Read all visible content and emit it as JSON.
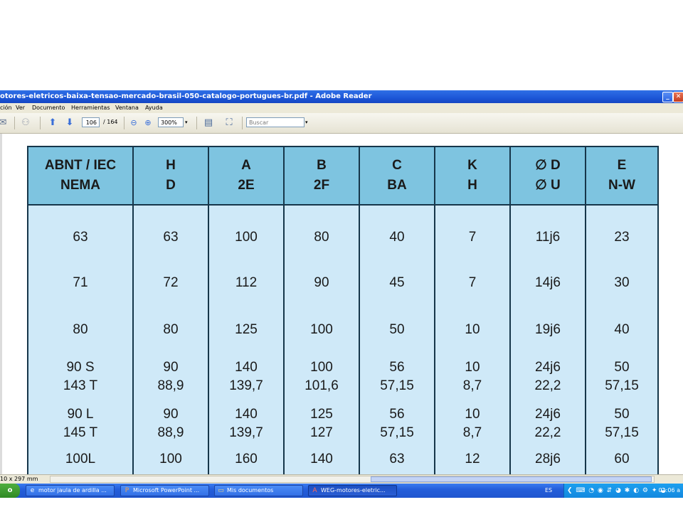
{
  "window": {
    "title": "otores-eletricos-baixa-tensao-mercado-brasil-050-catalogo-portugues-br.pdf - Adobe Reader",
    "minimize_glyph": "_",
    "maximize_glyph": "□",
    "close_glyph": "✕"
  },
  "menu": {
    "items": [
      "ción",
      "Ver",
      "Documento",
      "Herramientas",
      "Ventana",
      "Ayuda"
    ]
  },
  "toolbar": {
    "page_current": "106",
    "page_total": "/ 164",
    "zoom": "300%",
    "search_placeholder": "Buscar"
  },
  "table": {
    "headers": [
      [
        "ABNT / IEC",
        "NEMA"
      ],
      [
        "H",
        "D"
      ],
      [
        "A",
        "2E"
      ],
      [
        "B",
        "2F"
      ],
      [
        "C",
        "BA"
      ],
      [
        "K",
        "H"
      ],
      [
        "∅ D",
        "∅ U"
      ],
      [
        "E",
        "N-W"
      ]
    ],
    "rows": [
      [
        [
          "63"
        ],
        [
          "63"
        ],
        [
          "100"
        ],
        [
          "80"
        ],
        [
          "40"
        ],
        [
          "7"
        ],
        [
          "11j6"
        ],
        [
          "23"
        ]
      ],
      [
        [
          "71"
        ],
        [
          "72"
        ],
        [
          "112"
        ],
        [
          "90"
        ],
        [
          "45"
        ],
        [
          "7"
        ],
        [
          "14j6"
        ],
        [
          "30"
        ]
      ],
      [
        [
          "80"
        ],
        [
          "80"
        ],
        [
          "125"
        ],
        [
          "100"
        ],
        [
          "50"
        ],
        [
          "10"
        ],
        [
          "19j6"
        ],
        [
          "40"
        ]
      ],
      [
        [
          "90 S",
          "143 T"
        ],
        [
          "90",
          "88,9"
        ],
        [
          "140",
          "139,7"
        ],
        [
          "100",
          "101,6"
        ],
        [
          "56",
          "57,15"
        ],
        [
          "10",
          "8,7"
        ],
        [
          "24j6",
          "22,2"
        ],
        [
          "50",
          "57,15"
        ]
      ],
      [
        [
          "90 L",
          "145 T"
        ],
        [
          "90",
          "88,9"
        ],
        [
          "140",
          "139,7"
        ],
        [
          "125",
          "127"
        ],
        [
          "56",
          "57,15"
        ],
        [
          "10",
          "8,7"
        ],
        [
          "24j6",
          "22,2"
        ],
        [
          "50",
          "57,15"
        ]
      ],
      [
        [
          "100L"
        ],
        [
          "100"
        ],
        [
          "160"
        ],
        [
          "140"
        ],
        [
          "63"
        ],
        [
          "12"
        ],
        [
          "28j6"
        ],
        [
          "60"
        ]
      ]
    ]
  },
  "statusbar": {
    "page_size": "10 x 297 mm"
  },
  "taskbar": {
    "start_label": "o",
    "tasks": [
      {
        "label": "motor jaula de ardilla ...",
        "icon": "internet-explorer-icon",
        "glyph": "e"
      },
      {
        "label": "Microsoft PowerPoint ...",
        "icon": "powerpoint-icon",
        "glyph": "P"
      },
      {
        "label": "Mis documentos",
        "icon": "folder-icon",
        "glyph": "▭"
      },
      {
        "label": "WEG-motores-eletric...",
        "icon": "adobe-reader-icon",
        "glyph": "A"
      }
    ],
    "language": "ES",
    "tray_icons": "❮ ⌨ ◔ ◉ ⇵ ◕ ✱ ◐ ⚙ ✦ ◒",
    "clock": "01:06 a"
  },
  "colors": {
    "header_bg": "#7ec4e0",
    "body_bg": "#cfe9f8",
    "border": "#16364a",
    "titlebar": "#1c56d7"
  }
}
